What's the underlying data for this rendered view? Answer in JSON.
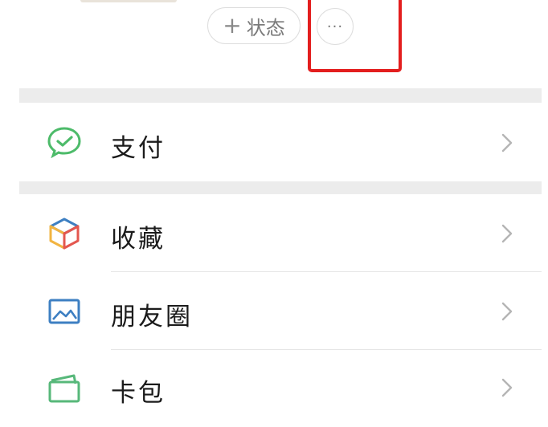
{
  "profile": {
    "status_button_label": "状态",
    "more_button_label": "···"
  },
  "menu": {
    "items": [
      {
        "label": "支付",
        "icon": "wechat-pay-icon",
        "icon_color": "#4dbb6a"
      },
      {
        "label": "收藏",
        "icon": "favorites-cube-icon",
        "icon_color": "#f2b441"
      },
      {
        "label": "朋友圈",
        "icon": "moments-picture-icon",
        "icon_color": "#3d7fc2"
      },
      {
        "label": "卡包",
        "icon": "card-wallet-icon",
        "icon_color": "#57b87a"
      }
    ]
  },
  "colors": {
    "highlight": "#e31e1e",
    "section_gap": "#ececec"
  }
}
